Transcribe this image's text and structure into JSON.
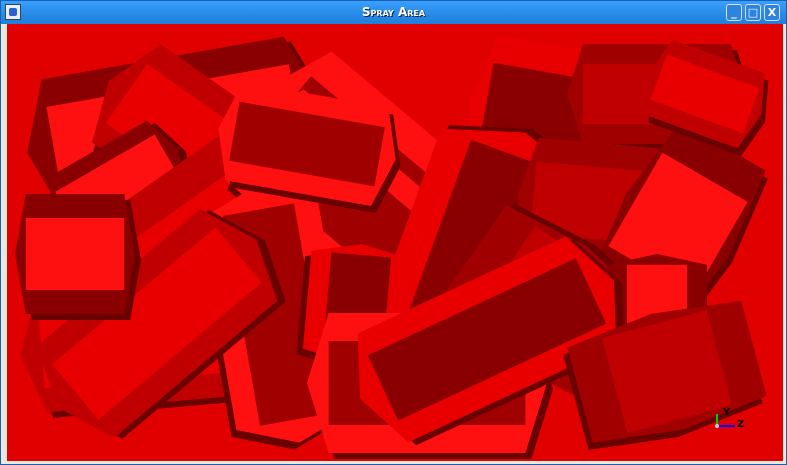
{
  "window": {
    "title": "Spray Area",
    "minimize_icon": "minimize-icon",
    "maximize_icon": "maximize-icon",
    "close_icon": "close-icon"
  },
  "scene": {
    "crystal_color": "#e00000",
    "axis_labels": {
      "y": "Y",
      "z": "Z"
    }
  }
}
